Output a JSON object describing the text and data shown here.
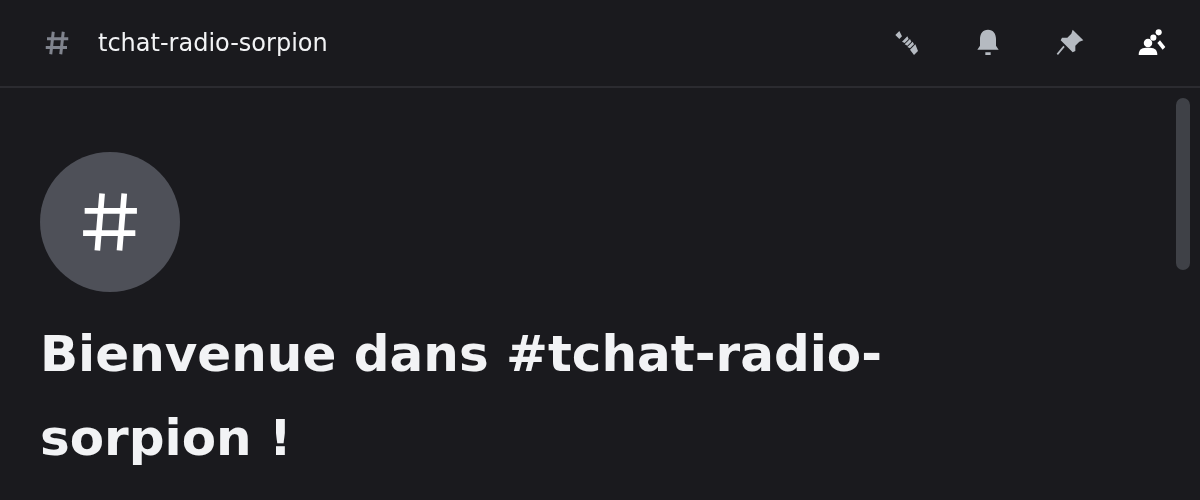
{
  "header": {
    "channel_name": "tchat-radio-sorpion"
  },
  "toolbar": [
    {
      "kind": "threads",
      "active": false
    },
    {
      "kind": "notifications",
      "active": false
    },
    {
      "kind": "pins",
      "active": false
    },
    {
      "kind": "members",
      "active": true
    }
  ],
  "welcome": {
    "title": "Bienvenue dans #tchat-radio-sorpion !"
  }
}
